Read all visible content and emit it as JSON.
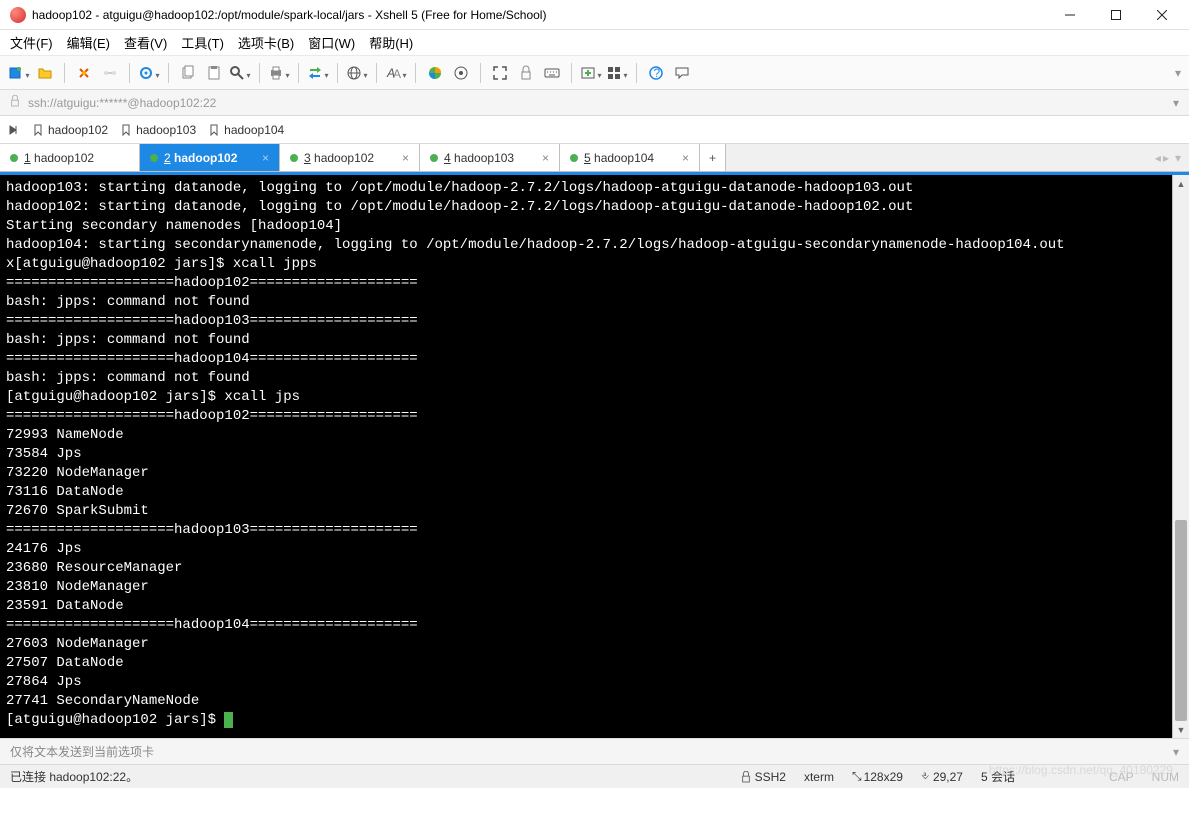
{
  "window": {
    "title": "hadoop102 - atguigu@hadoop102:/opt/module/spark-local/jars - Xshell 5 (Free for Home/School)"
  },
  "menu": {
    "items": [
      "文件(F)",
      "编辑(E)",
      "查看(V)",
      "工具(T)",
      "选项卡(B)",
      "窗口(W)",
      "帮助(H)"
    ]
  },
  "address": {
    "url": "ssh://atguigu:******@hadoop102:22"
  },
  "quickbar": {
    "items": [
      "hadoop102",
      "hadoop103",
      "hadoop104"
    ]
  },
  "tabs": {
    "items": [
      {
        "index": "1",
        "label": "hadoop102",
        "active": false
      },
      {
        "index": "2",
        "label": "hadoop102",
        "active": true
      },
      {
        "index": "3",
        "label": "hadoop102",
        "active": false
      },
      {
        "index": "4",
        "label": "hadoop103",
        "active": false
      },
      {
        "index": "5",
        "label": "hadoop104",
        "active": false
      }
    ]
  },
  "terminal": {
    "lines": [
      "hadoop103: starting datanode, logging to /opt/module/hadoop-2.7.2/logs/hadoop-atguigu-datanode-hadoop103.out",
      "hadoop102: starting datanode, logging to /opt/module/hadoop-2.7.2/logs/hadoop-atguigu-datanode-hadoop102.out",
      "Starting secondary namenodes [hadoop104]",
      "hadoop104: starting secondarynamenode, logging to /opt/module/hadoop-2.7.2/logs/hadoop-atguigu-secondarynamenode-hadoop104.out",
      "x[atguigu@hadoop102 jars]$ xcall jpps",
      "====================hadoop102====================",
      "bash: jpps: command not found",
      "====================hadoop103====================",
      "bash: jpps: command not found",
      "====================hadoop104====================",
      "bash: jpps: command not found",
      "[atguigu@hadoop102 jars]$ xcall jps",
      "====================hadoop102====================",
      "72993 NameNode",
      "73584 Jps",
      "73220 NodeManager",
      "73116 DataNode",
      "72670 SparkSubmit",
      "====================hadoop103====================",
      "24176 Jps",
      "23680 ResourceManager",
      "23810 NodeManager",
      "23591 DataNode",
      "====================hadoop104====================",
      "27603 NodeManager",
      "27507 DataNode",
      "27864 Jps",
      "27741 SecondaryNameNode",
      "[atguigu@hadoop102 jars]$ "
    ]
  },
  "scrollbar": {
    "thumb_top_pct": 62,
    "thumb_height_pct": 38,
    "thumb_color": "#b0b0b0"
  },
  "sendbar": {
    "text": "仅将文本发送到当前选项卡"
  },
  "status": {
    "connected": "已连接 hadoop102:22。",
    "proto": "SSH2",
    "term": "xterm",
    "size": "128x29",
    "cursor": "29,27",
    "sessions": "5 会话",
    "cap": "CAP",
    "num": "NUM"
  },
  "watermark": "https://blog.csdn.net/qq_40180229"
}
